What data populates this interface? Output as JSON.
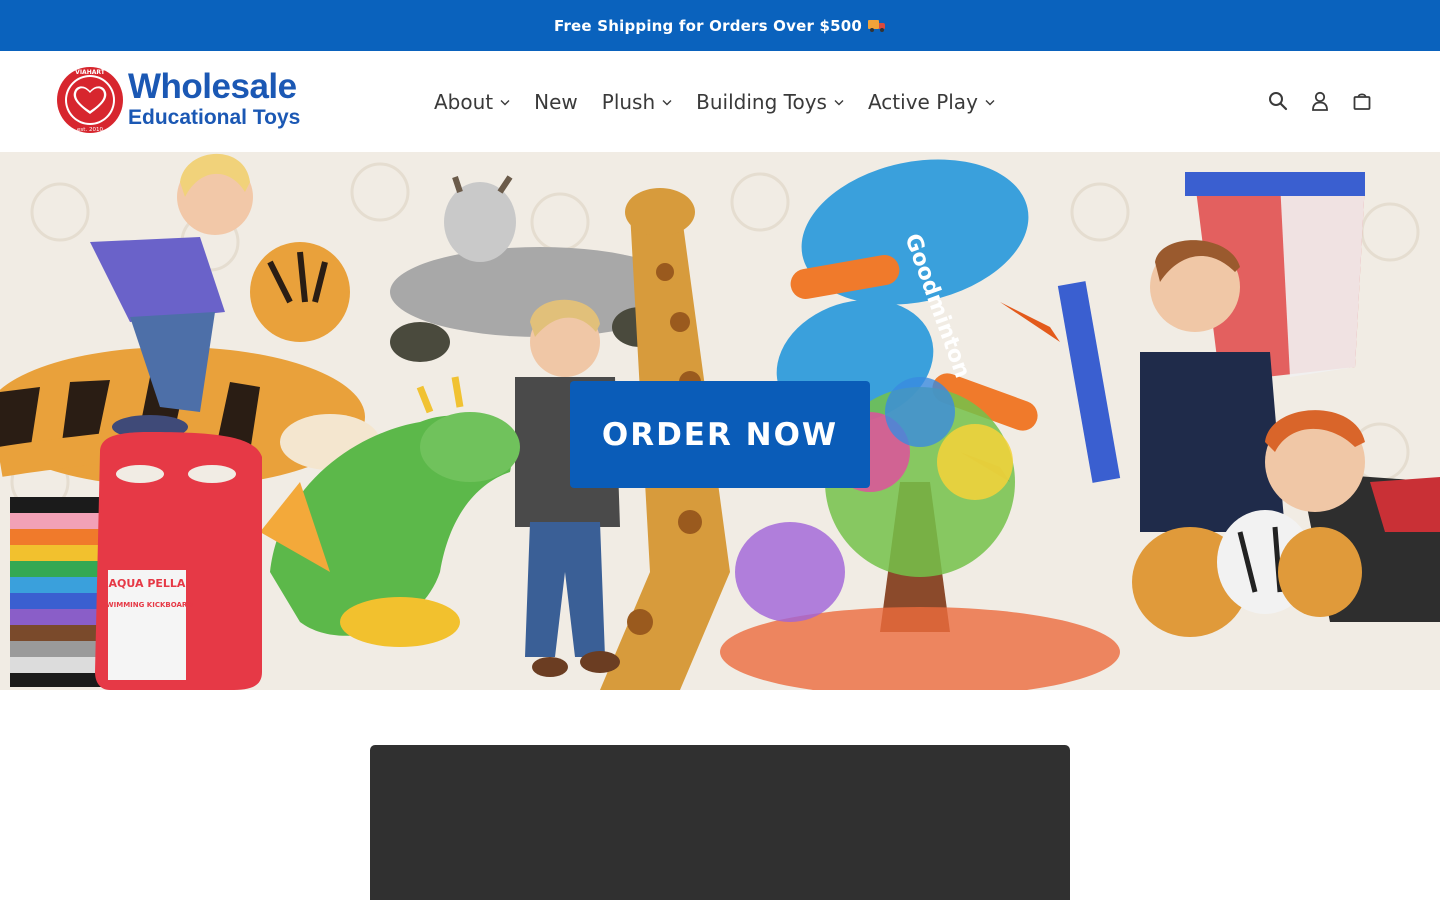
{
  "announcement": {
    "text": "Free Shipping for Orders Over $500",
    "icon": "truck-icon"
  },
  "header": {
    "logo": {
      "line1": "Wholesale",
      "line2": "Educational Toys",
      "badge_top": "VIAHART",
      "badge_bottom": "est. 2010"
    },
    "nav": [
      {
        "label": "About",
        "has_dropdown": true
      },
      {
        "label": "New",
        "has_dropdown": false
      },
      {
        "label": "Plush",
        "has_dropdown": true
      },
      {
        "label": "Building Toys",
        "has_dropdown": true
      },
      {
        "label": "Active Play",
        "has_dropdown": true
      }
    ],
    "icons": [
      "search-icon",
      "account-icon",
      "cart-icon"
    ]
  },
  "hero": {
    "button_label": "ORDER NOW",
    "product_labels": {
      "paddle_brand": "Goodminton",
      "kickboard_brand": "AQUA PELLA",
      "kickboard_title": "SWIMMING KICKBOARD"
    }
  },
  "colors": {
    "announcement_bg": "#0a62bd",
    "brand_blue": "#1b58b4",
    "button_bg": "#0a5cb8",
    "logo_red": "#d7262e",
    "video_bg": "#303030"
  }
}
